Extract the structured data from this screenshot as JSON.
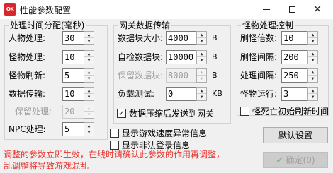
{
  "window": {
    "icon_text": "OK",
    "title": "性能参数配置",
    "minimize_icon": "minimize-icon",
    "maximize_icon": "maximize-icon",
    "close_icon": "close-icon"
  },
  "time_group": {
    "title": "处理时间分配(毫秒)",
    "fields": [
      {
        "label": "人物处理:",
        "value": "30",
        "enabled": true
      },
      {
        "label": "怪物处理:",
        "value": "10",
        "enabled": true
      },
      {
        "label": "怪物刷新:",
        "value": "5",
        "enabled": true
      },
      {
        "label": "数据传输:",
        "value": "10",
        "enabled": true
      },
      {
        "label": "保留处理:",
        "value": "20",
        "enabled": false
      },
      {
        "label": "NPC处理:",
        "value": "5",
        "enabled": true
      }
    ]
  },
  "gateway_group": {
    "title": "网关数据传输",
    "fields": [
      {
        "label": "数据块大小:",
        "value": "4000",
        "unit": "B",
        "enabled": true
      },
      {
        "label": "自检数据块:",
        "value": "10000",
        "unit": "B",
        "enabled": true
      },
      {
        "label": "保留数据块:",
        "value": "8000",
        "unit": "B",
        "enabled": false
      },
      {
        "label": "负载测试:",
        "value": "0",
        "unit": "KB",
        "enabled": true
      }
    ],
    "compress_label": "数据压缩后发送到网关",
    "compress_checked": true
  },
  "options": {
    "show_speed_label": "显示游戏速度异常信息",
    "show_speed_checked": false,
    "show_login_label": "显示非法登录信息",
    "show_login_checked": false
  },
  "monster_group": {
    "title": "怪物处理控制",
    "fields": [
      {
        "label": "刷怪倍数:",
        "value": "10"
      },
      {
        "label": "刷怪间隔:",
        "value": "200"
      },
      {
        "label": "处理间隔:",
        "value": "250"
      },
      {
        "label": "怪物运行:",
        "value": "3"
      }
    ],
    "monster_dead_label": "怪死亡初始刷新时间",
    "monster_dead_checked": false
  },
  "buttons": {
    "default_label": "默认设置",
    "ok_label": "确定(0)"
  },
  "warning": {
    "line1": "调整的参数立即生效，在线时请确认此参数的作用再调整，",
    "line2": "乱调整将导致游戏混乱",
    "color": "#e8322c"
  }
}
